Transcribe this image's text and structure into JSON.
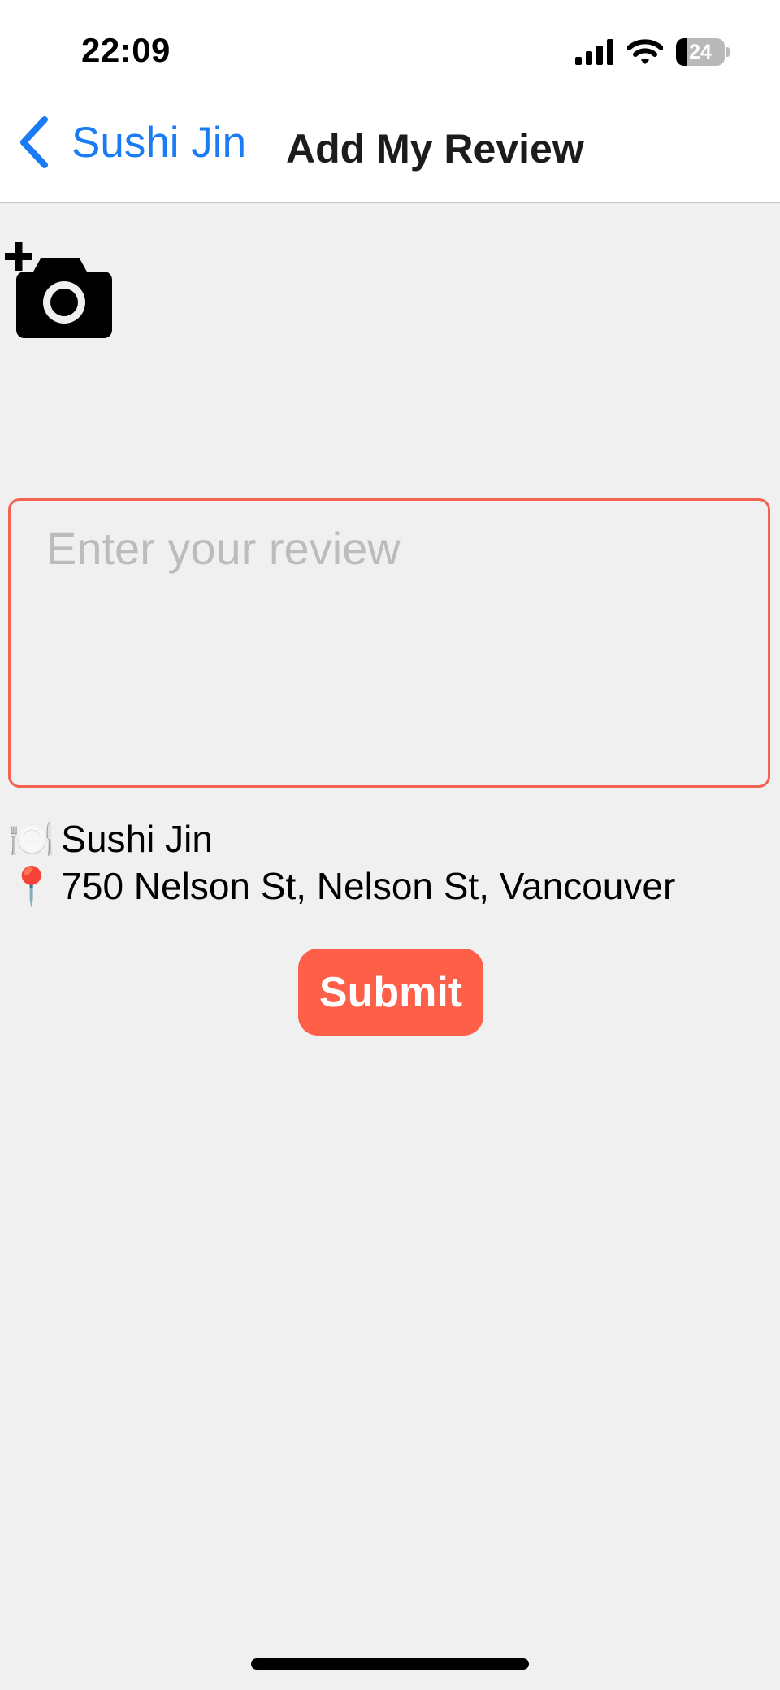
{
  "status_bar": {
    "time": "22:09",
    "battery_level": "24",
    "battery_fraction": 0.24,
    "icons": [
      "cellular-signal-icon",
      "wifi-icon",
      "battery-icon"
    ]
  },
  "nav": {
    "back_label": "Sushi Jin",
    "title": "Add My Review",
    "back_icon": "chevron-left-icon"
  },
  "photo": {
    "icon": "add-photo-camera-icon"
  },
  "review": {
    "placeholder": "Enter your review",
    "value": ""
  },
  "restaurant": {
    "name_icon": "🍽️",
    "name": "Sushi Jin",
    "address_icon": "📍",
    "address": "750 Nelson St, Nelson St, Vancouver"
  },
  "submit": {
    "label": "Submit"
  },
  "colors": {
    "accent_blue": "#1a7cf5",
    "submit_red": "#fe5f49",
    "review_border": "#f26451",
    "background": "#f1f0f1"
  }
}
